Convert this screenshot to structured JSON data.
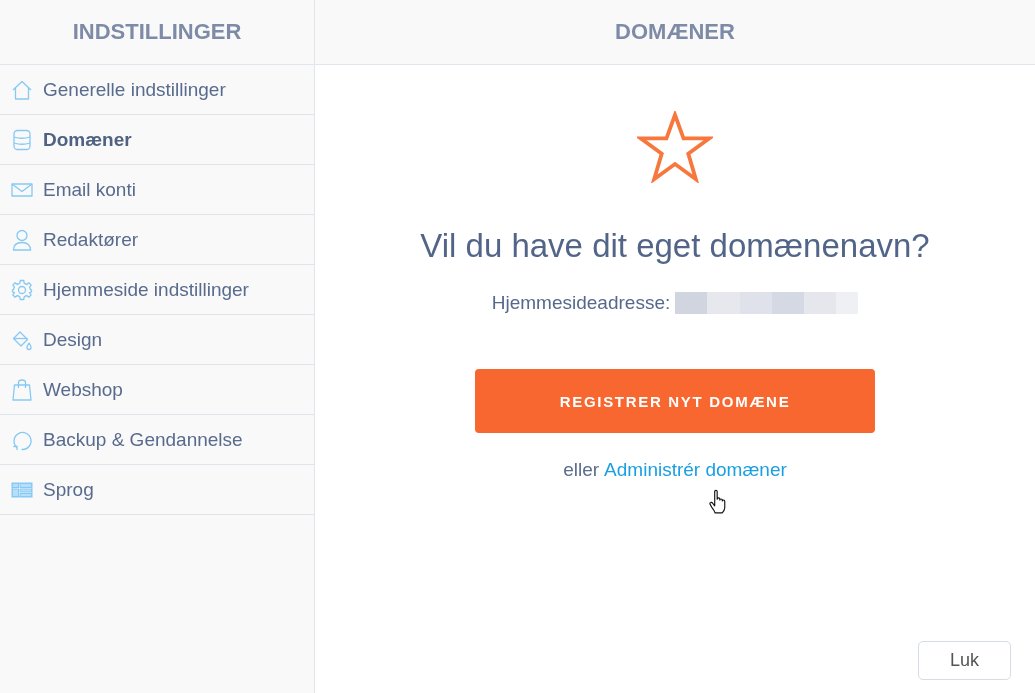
{
  "sidebar": {
    "title": "INDSTILLINGER",
    "items": [
      {
        "label": "Generelle indstillinger",
        "selected": false
      },
      {
        "label": "Domæner",
        "selected": true
      },
      {
        "label": "Email konti",
        "selected": false
      },
      {
        "label": "Redaktører",
        "selected": false
      },
      {
        "label": "Hjemmeside indstillinger",
        "selected": false
      },
      {
        "label": "Design",
        "selected": false
      },
      {
        "label": "Webshop",
        "selected": false
      },
      {
        "label": "Backup & Gendannelse",
        "selected": false
      },
      {
        "label": "Sprog",
        "selected": false
      }
    ]
  },
  "panel": {
    "title": "DOMÆNER",
    "heading": "Vil du have dit eget domænenavn?",
    "address_label": "Hjemmesideadresse:",
    "register_button": "REGISTRER NYT DOMÆNE",
    "alternative_prefix": "eller",
    "manage_link": "Administrér domæner",
    "close_button": "Luk"
  }
}
